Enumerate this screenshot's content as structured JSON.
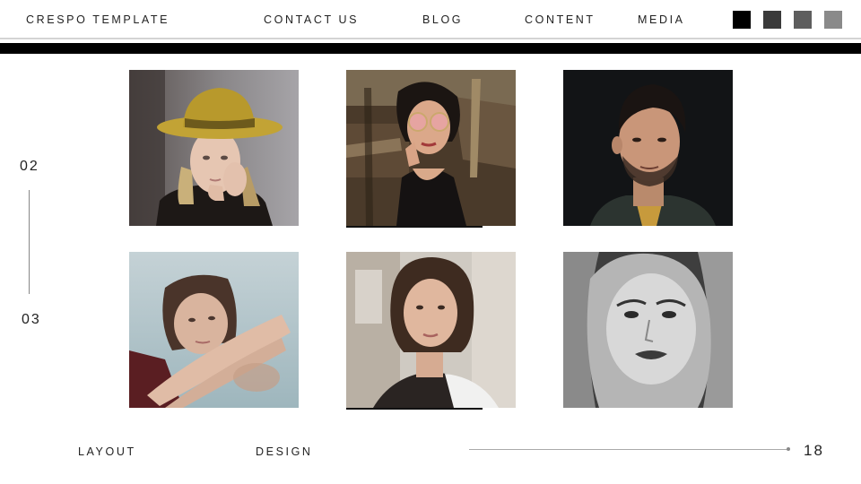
{
  "header": {
    "brand": "CRESPO TEMPLATE",
    "nav": [
      "CONTACT US",
      "BLOG",
      "CONTENT",
      "MEDIA"
    ],
    "swatches": [
      "#000000",
      "#3a3a3a",
      "#5e5e5e",
      "#8a8a8a"
    ]
  },
  "sidebar": {
    "top_number": "02",
    "bottom_number": "03"
  },
  "gallery": {
    "photos": [
      {
        "name": "woman-yellow-hat"
      },
      {
        "name": "woman-pink-sunglasses"
      },
      {
        "name": "man-portrait"
      },
      {
        "name": "woman-reflection"
      },
      {
        "name": "woman-white-shirt"
      },
      {
        "name": "woman-monochrome"
      }
    ]
  },
  "footer": {
    "left_label": "LAYOUT",
    "right_label": "DESIGN",
    "page_number": "18"
  }
}
